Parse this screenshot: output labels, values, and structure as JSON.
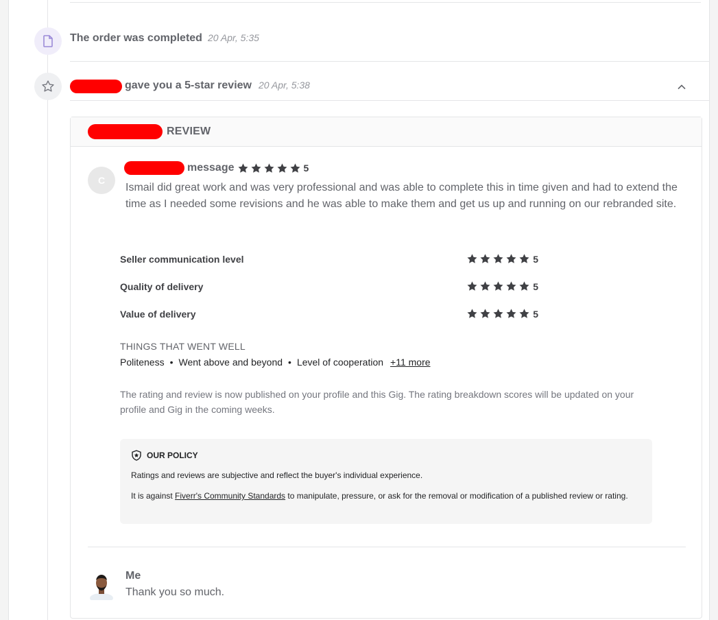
{
  "events": {
    "completed": {
      "title": "The order was completed",
      "time": "20 Apr, 5:35",
      "icon": "document-icon"
    },
    "review": {
      "title": "gave you a 5-star review",
      "time": "20 Apr, 5:38",
      "icon": "star-outline-icon",
      "toggle_icon": "chevron-up-icon"
    }
  },
  "review_panel": {
    "header_label": "REVIEW",
    "reviewer": {
      "avatar_initial": "C",
      "label": "message",
      "rating": "5",
      "text": "Ismail did great work and was very professional and was able to complete this in time given and had to extend the time as I needed some revisions and he was able to make them and get us up and running on our rebranded site."
    },
    "sub_ratings": [
      {
        "label": "Seller communication level",
        "rating": "5"
      },
      {
        "label": "Quality of delivery",
        "rating": "5"
      },
      {
        "label": "Value of delivery",
        "rating": "5"
      }
    ],
    "went_well": {
      "title": "THINGS THAT WENT WELL",
      "items": [
        "Politeness",
        "Went above and beyond",
        "Level of cooperation"
      ],
      "separator": "•",
      "more": "+11 more"
    },
    "published_note": "The rating and review is now published on your profile and this Gig. The rating breakdown scores will be updated on your profile and Gig in the coming weeks.",
    "policy": {
      "title": "OUR POLICY",
      "line1": "Ratings and reviews are subjective and reflect the buyer's individual experience.",
      "line2_prefix": "It is against",
      "line2_link": "Fiverr's Community Standards",
      "line2_suffix": "to manipulate, pressure, or ask for the removal or modification of a published review or rating."
    },
    "reply": {
      "name": "Me",
      "text": "Thank you so much."
    }
  },
  "colors": {
    "redaction": "#ff0000",
    "star": "#404145",
    "completed_icon_bg": "#f0edfa",
    "completed_icon": "#9b8ad8"
  }
}
